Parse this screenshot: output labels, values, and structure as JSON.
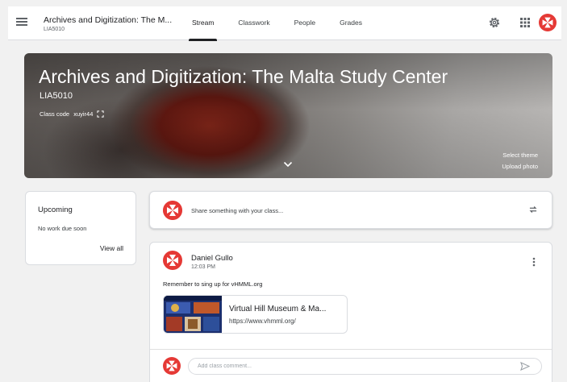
{
  "header": {
    "class_title": "Archives and Digitization: The M...",
    "class_section": "LIA5010",
    "tabs": [
      {
        "label": "Stream",
        "active": true
      },
      {
        "label": "Classwork",
        "active": false
      },
      {
        "label": "People",
        "active": false
      },
      {
        "label": "Grades",
        "active": false
      }
    ],
    "icons": [
      "menu-icon",
      "gear-icon",
      "apps-grid-icon",
      "avatar"
    ]
  },
  "banner": {
    "title": "Archives and Digitization: The Malta Study Center",
    "section": "LIA5010",
    "class_code_label": "Class code",
    "class_code": "xuyir44",
    "select_theme": "Select theme",
    "upload_photo": "Upload photo"
  },
  "upcoming": {
    "title": "Upcoming",
    "status": "No work due soon",
    "view_all": "View all"
  },
  "share": {
    "placeholder": "Share something with your class..."
  },
  "post": {
    "author": "Daniel Gullo",
    "time": "12:03 PM",
    "body": "Remember to sing up for vHMML.org",
    "attachment": {
      "title": "Virtual Hill Museum & Ma...",
      "url": "https://www.vhmml.org/"
    },
    "comment_placeholder": "Add class comment..."
  },
  "colors": {
    "accent": "#202124",
    "avatar_red": "#e53935",
    "background": "#f1f1f1"
  }
}
